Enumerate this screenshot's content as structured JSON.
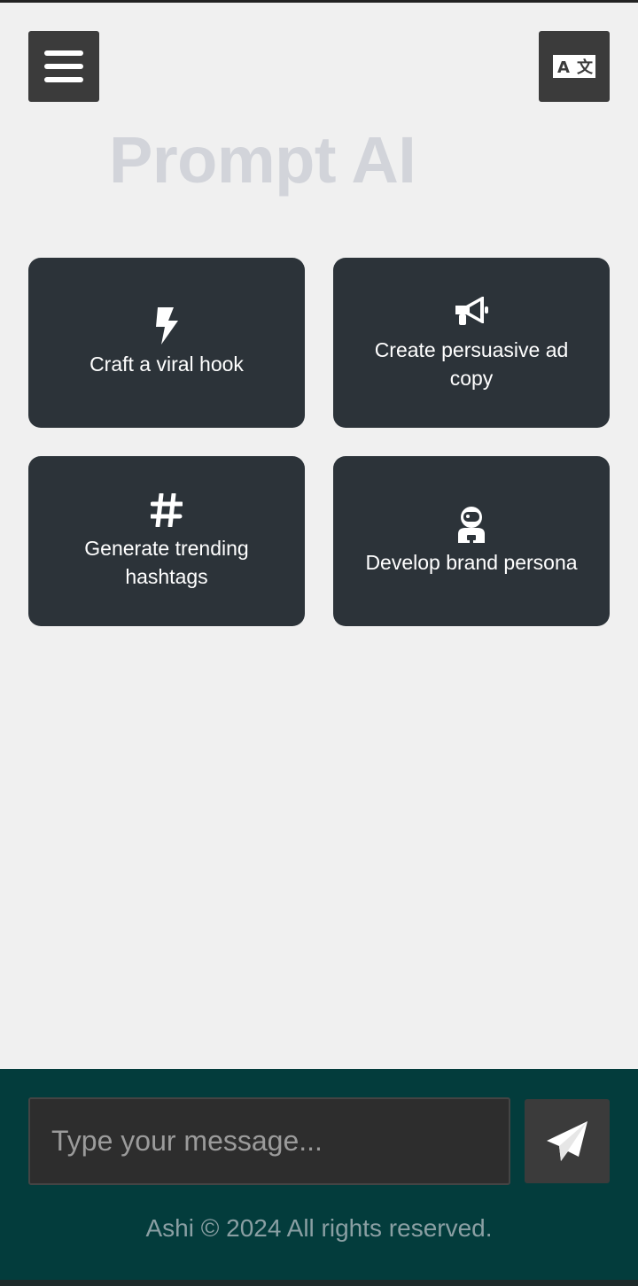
{
  "header": {
    "menu_icon": "hamburger-menu-icon",
    "translate_icon": "translate-icon",
    "title": "Prompt AI"
  },
  "suggestions": [
    {
      "icon": "bolt-icon",
      "label": "Craft a viral hook"
    },
    {
      "icon": "megaphone-icon",
      "label": "Create persuasive ad copy"
    },
    {
      "icon": "hashtag-icon",
      "label": "Generate trending hashtags"
    },
    {
      "icon": "astronaut-icon",
      "label": "Develop brand persona"
    }
  ],
  "composer": {
    "placeholder": "Type your message...",
    "value": "",
    "send_icon": "paper-plane-icon"
  },
  "footer": {
    "copyright": "Ashi © 2024 All rights reserved."
  },
  "colors": {
    "page_bg": "#f0f0f0",
    "card_bg": "#2c3339",
    "button_bg": "#3b3b3b",
    "footer_bg": "#033c3c",
    "title_color": "#d2d4da"
  }
}
